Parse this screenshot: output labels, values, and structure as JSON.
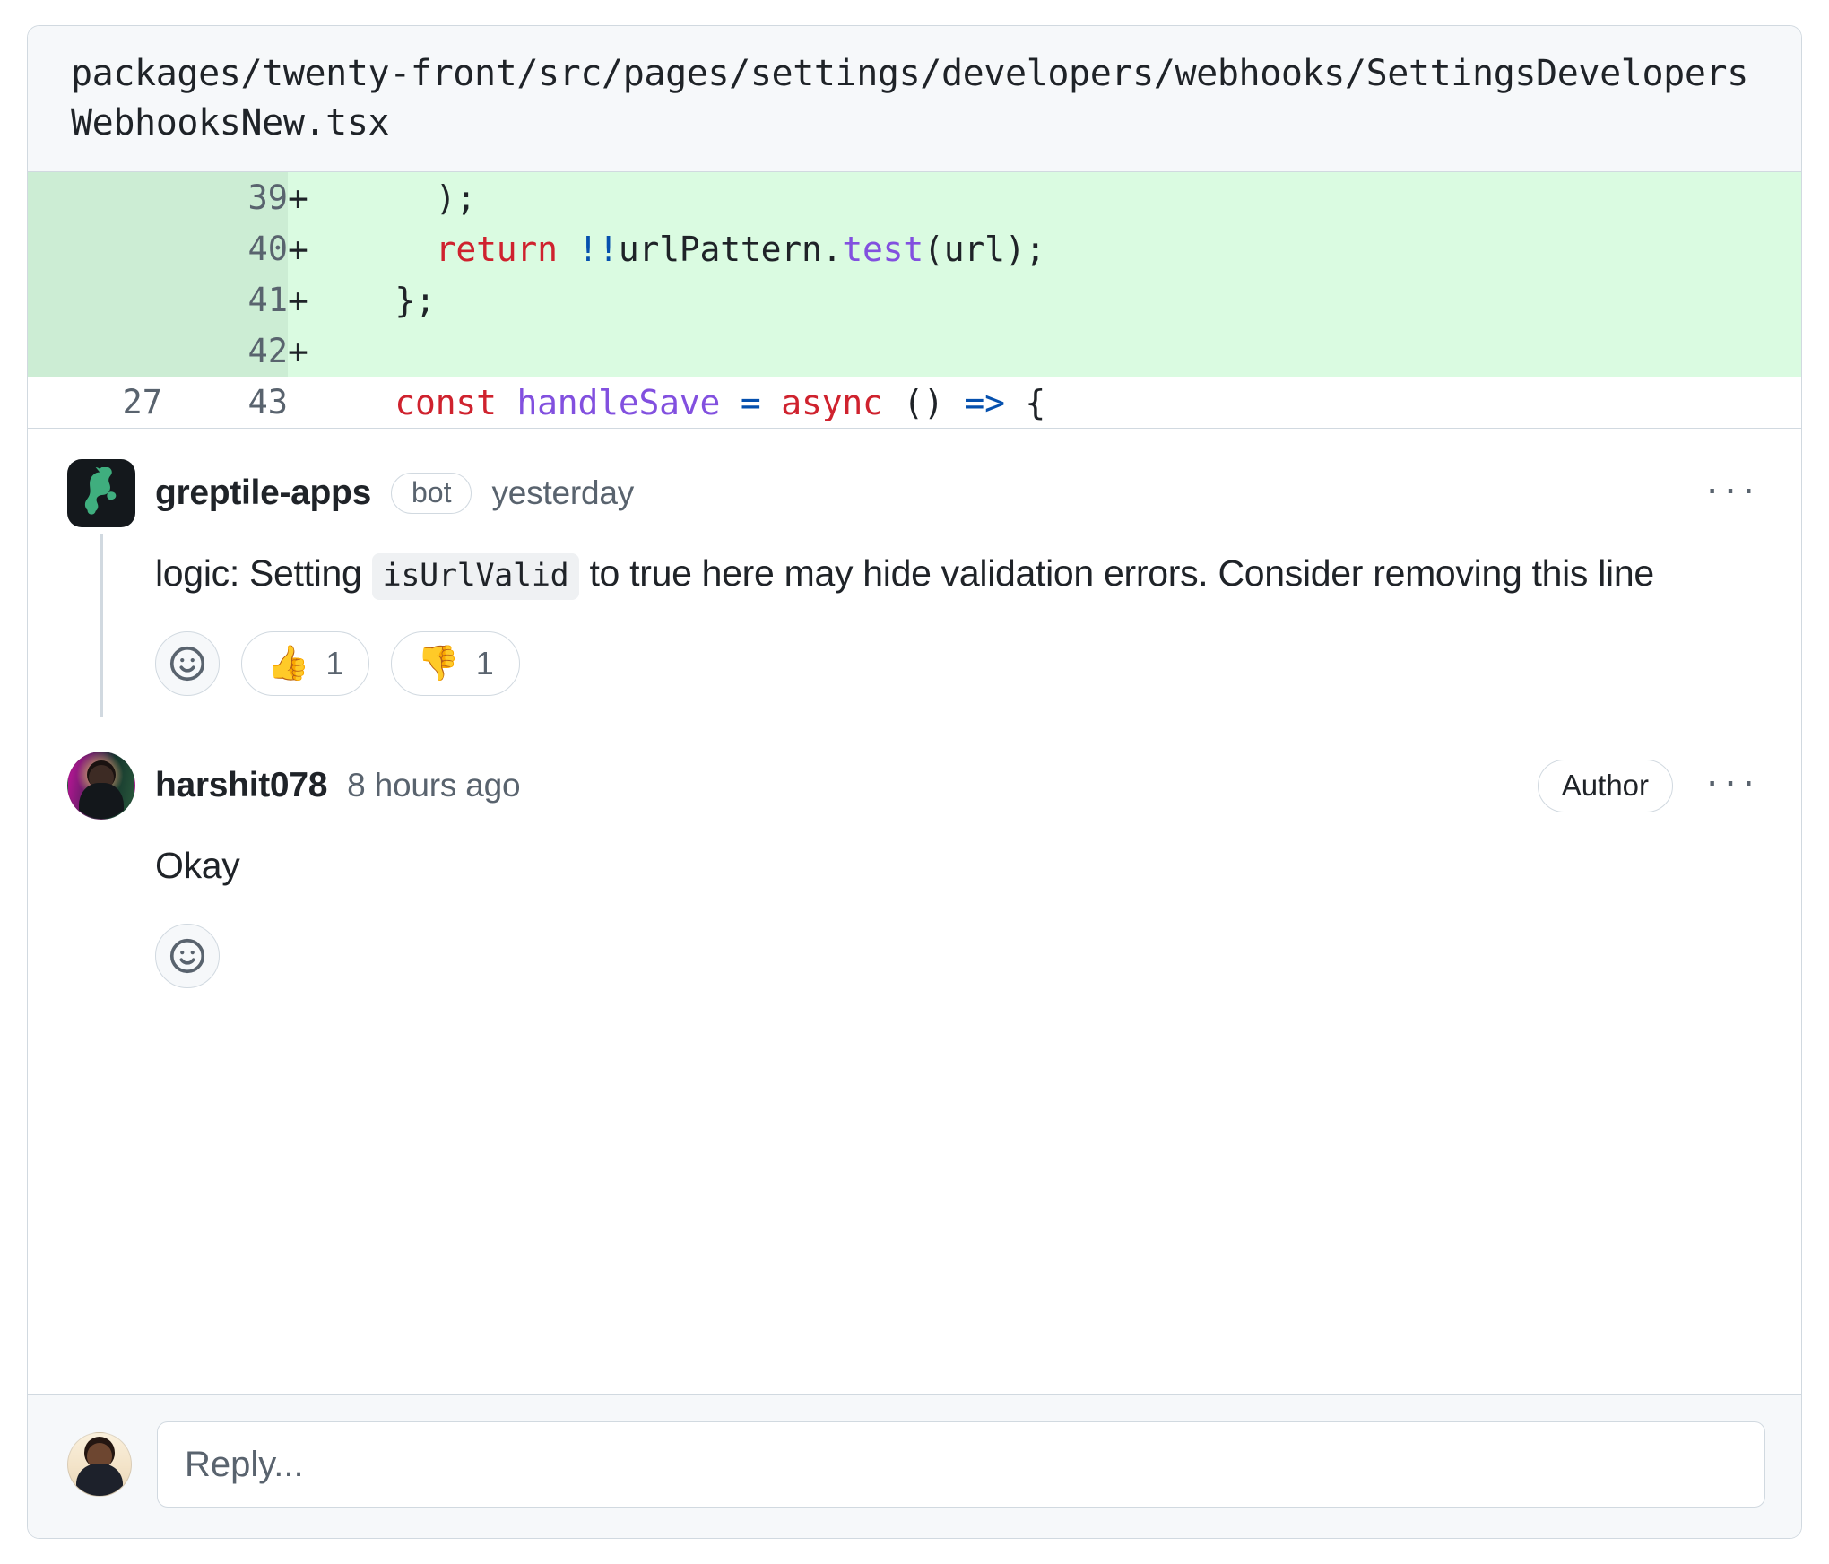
{
  "file": {
    "path": "packages/twenty-front/src/pages/settings/developers/webhooks/SettingsDevelopersWebhooksNew.tsx"
  },
  "diff": {
    "rows": [
      {
        "old": "",
        "new": "39",
        "marker": "+",
        "type": "add",
        "tokens": [
          {
            "text": "    );",
            "cls": "tok-pl"
          }
        ]
      },
      {
        "old": "",
        "new": "40",
        "marker": "+",
        "type": "add",
        "tokens": [
          {
            "text": "    ",
            "cls": "tok-pl"
          },
          {
            "text": "return",
            "cls": "tok-kw"
          },
          {
            "text": " ",
            "cls": "tok-pl"
          },
          {
            "text": "!!",
            "cls": "tok-op"
          },
          {
            "text": "urlPattern",
            "cls": "tok-pl"
          },
          {
            "text": ".",
            "cls": "tok-pl"
          },
          {
            "text": "test",
            "cls": "tok-fn"
          },
          {
            "text": "(url);",
            "cls": "tok-pl"
          }
        ]
      },
      {
        "old": "",
        "new": "41",
        "marker": "+",
        "type": "add",
        "tokens": [
          {
            "text": "  };",
            "cls": "tok-pl"
          }
        ]
      },
      {
        "old": "",
        "new": "42",
        "marker": "+",
        "type": "add",
        "tokens": [
          {
            "text": "",
            "cls": "tok-pl"
          }
        ]
      },
      {
        "old": "27",
        "new": "43",
        "marker": "",
        "type": "ctx",
        "tokens": [
          {
            "text": "  ",
            "cls": "tok-pl"
          },
          {
            "text": "const",
            "cls": "tok-kw"
          },
          {
            "text": " ",
            "cls": "tok-pl"
          },
          {
            "text": "handleSave",
            "cls": "tok-var"
          },
          {
            "text": " ",
            "cls": "tok-pl"
          },
          {
            "text": "=",
            "cls": "tok-op"
          },
          {
            "text": " ",
            "cls": "tok-pl"
          },
          {
            "text": "async",
            "cls": "tok-kw"
          },
          {
            "text": " () ",
            "cls": "tok-pl"
          },
          {
            "text": "=>",
            "cls": "tok-op"
          },
          {
            "text": " {",
            "cls": "tok-pl"
          }
        ]
      }
    ]
  },
  "comments": [
    {
      "author": "greptile-apps",
      "badge": "bot",
      "timestamp": "yesterday",
      "avatar": "greptile-bot-avatar",
      "body_parts": [
        {
          "type": "text",
          "text": "logic: Setting "
        },
        {
          "type": "code",
          "text": "isUrlValid"
        },
        {
          "type": "text",
          "text": " to true here may hide validation errors. Consider removing this line"
        }
      ],
      "reactions": [
        {
          "emoji": "👍",
          "count": "1",
          "name": "thumbs-up-reaction"
        },
        {
          "emoji": "👎",
          "count": "1",
          "name": "thumbs-down-reaction"
        }
      ],
      "menu": "···"
    },
    {
      "author": "harshit078",
      "badge": "",
      "timestamp": "8 hours ago",
      "avatar": "harshit-avatar",
      "author_badge": "Author",
      "body_parts": [
        {
          "type": "text",
          "text": "Okay"
        }
      ],
      "reactions": [],
      "menu": "···"
    }
  ],
  "reply": {
    "placeholder": "Reply...",
    "value": ""
  },
  "colors": {
    "diff_add_bg": "#dafbe1",
    "diff_add_gutter_bg": "#ccedd4",
    "border": "#d1d9e0",
    "muted_text": "#59636e",
    "text": "#1f2328",
    "header_bg": "#f6f8fa",
    "keyword": "#cf222e",
    "function": "#8250df",
    "operator": "#0550ae"
  }
}
